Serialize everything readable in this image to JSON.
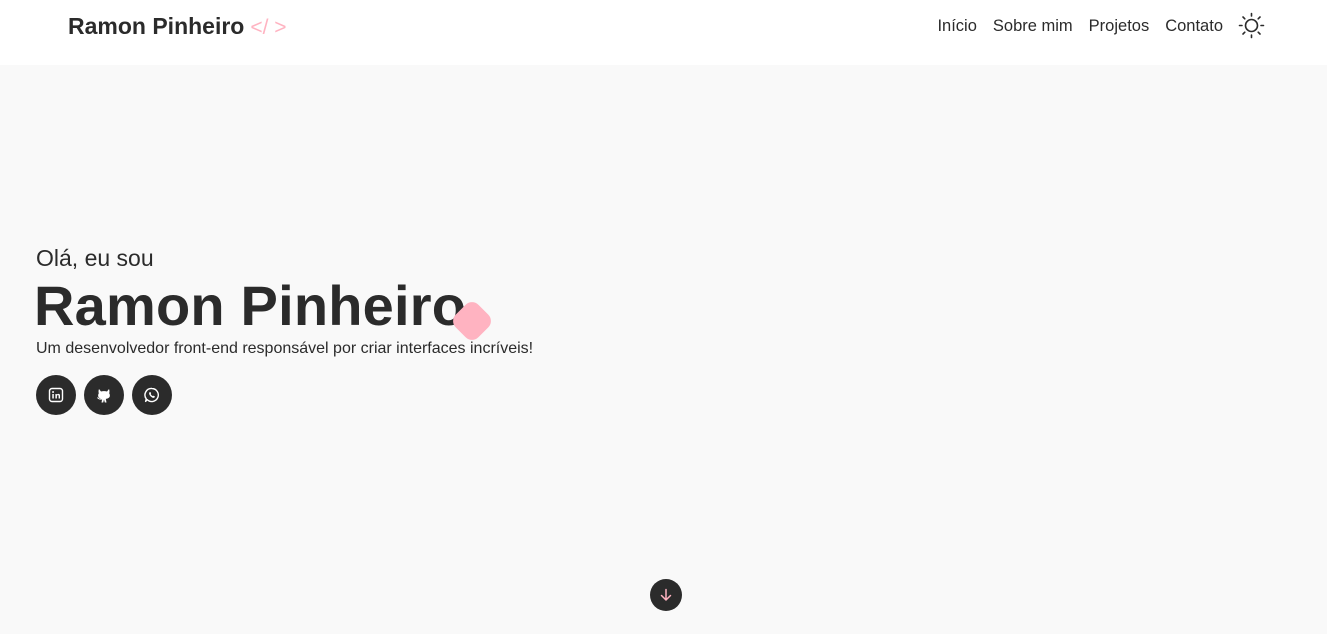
{
  "header": {
    "brand_name": "Ramon Pinheiro",
    "brand_code": "</ >",
    "nav": [
      {
        "label": "Início"
      },
      {
        "label": "Sobre mim"
      },
      {
        "label": "Projetos"
      },
      {
        "label": "Contato"
      }
    ],
    "theme_toggle_icon": "sun-icon"
  },
  "hero": {
    "greeting": "Olá, eu sou",
    "name": "Ramon Pinheiro",
    "subtitle": "Um desenvolvedor front-end responsável por criar interfaces incríveis!",
    "socials": [
      {
        "icon": "linkedin-icon"
      },
      {
        "icon": "github-icon"
      },
      {
        "icon": "whatsapp-icon"
      }
    ],
    "scroll_icon": "arrow-down-icon"
  },
  "colors": {
    "accent": "#ffb3c1",
    "dark": "#2b2b2b",
    "background": "#f9f9f9",
    "header_background": "#ffffff"
  }
}
